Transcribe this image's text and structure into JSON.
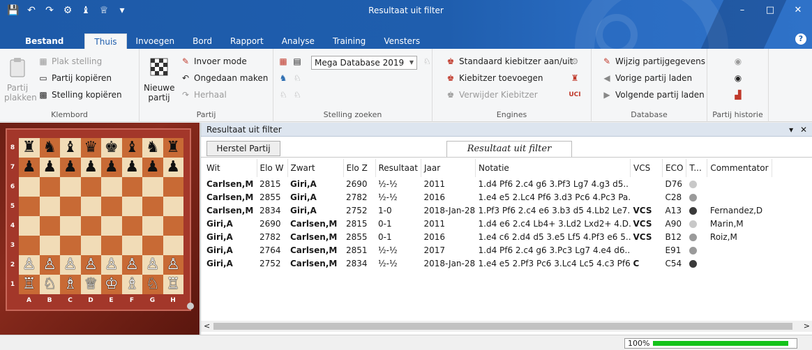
{
  "window": {
    "title": "Resultaat uit filter",
    "help": "?",
    "controls": {
      "minimize": "–",
      "maximize": "□",
      "close": "✕"
    }
  },
  "quick_access": [
    {
      "name": "save-icon",
      "glyph": "💾"
    },
    {
      "name": "undo-icon",
      "glyph": "↶"
    },
    {
      "name": "redo-icon",
      "glyph": "↷"
    },
    {
      "name": "engine-icon",
      "glyph": "⚙"
    },
    {
      "name": "analysis-icon",
      "glyph": "♝"
    },
    {
      "name": "trophy-icon",
      "glyph": "♕"
    },
    {
      "name": "customize-icon",
      "glyph": "▾"
    }
  ],
  "tabs": [
    {
      "label": "Bestand",
      "active": false
    },
    {
      "label": "Thuis",
      "active": true
    },
    {
      "label": "Invoegen",
      "active": false
    },
    {
      "label": "Bord",
      "active": false
    },
    {
      "label": "Rapport",
      "active": false
    },
    {
      "label": "Analyse",
      "active": false
    },
    {
      "label": "Training",
      "active": false
    },
    {
      "label": "Vensters",
      "active": false
    }
  ],
  "ribbon": {
    "klembord": {
      "label": "Klembord",
      "partij_plakken": "Partij plakken",
      "plak_stelling": "Plak stelling",
      "partij_kopieren": "Partij kopiëren",
      "stelling_kopieren": "Stelling kopiëren"
    },
    "partij": {
      "label": "Partij",
      "nieuwe_partij": "Nieuwe partij",
      "invoer_mode": "Invoer mode",
      "ongedaan": "Ongedaan maken",
      "herhaal": "Herhaal"
    },
    "stelling_zoeken": {
      "label": "Stelling zoeken",
      "database": "Mega Database 2019"
    },
    "engines": {
      "label": "Engines",
      "standaard": "Standaard kiebitzer aan/uit",
      "toevoegen": "Kiebitzer toevoegen",
      "verwijder": "Verwijder Kiebitzer",
      "uci": "UCI"
    },
    "database": {
      "label": "Database",
      "wijzig": "Wijzig partijgegevens",
      "vorige": "Vorige partij laden",
      "volgende": "Volgende partij laden"
    },
    "historie": {
      "label": "Partij historie"
    }
  },
  "board": {
    "ranks": [
      "8",
      "7",
      "6",
      "5",
      "4",
      "3",
      "2",
      "1"
    ],
    "files": [
      "A",
      "B",
      "C",
      "D",
      "E",
      "F",
      "G",
      "H"
    ],
    "position": [
      [
        "♜",
        "♞",
        "♝",
        "♛",
        "♚",
        "♝",
        "♞",
        "♜"
      ],
      [
        "♟",
        "♟",
        "♟",
        "♟",
        "♟",
        "♟",
        "♟",
        "♟"
      ],
      [
        "",
        "",
        "",
        "",
        "",
        "",
        "",
        ""
      ],
      [
        "",
        "",
        "",
        "",
        "",
        "",
        "",
        ""
      ],
      [
        "",
        "",
        "",
        "",
        "",
        "",
        "",
        ""
      ],
      [
        "",
        "",
        "",
        "",
        "",
        "",
        "",
        ""
      ],
      [
        "♙",
        "♙",
        "♙",
        "♙",
        "♙",
        "♙",
        "♙",
        "♙"
      ],
      [
        "♖",
        "♘",
        "♗",
        "♕",
        "♔",
        "♗",
        "♘",
        "♖"
      ]
    ]
  },
  "results": {
    "panel_title": "Resultaat uit filter",
    "controls": {
      "menu": "▾",
      "close": "✕"
    },
    "herstel_button": "Herstel Partij",
    "filter_tab": "Resultaat uit filter",
    "columns": [
      "Wit",
      "Elo W",
      "Zwart",
      "Elo Z",
      "Resultaat",
      "Jaar",
      "Notatie",
      "VCS",
      "ECO",
      "T...",
      "Commentator"
    ],
    "rows": [
      {
        "wit": "Carlsen,M",
        "elo_w": "2815",
        "zwart": "Giri,A",
        "elo_z": "2690",
        "resultaat": "½-½",
        "jaar": "2011",
        "notatie": "1.d4 Pf6 2.c4 g6 3.Pf3 Lg7 4.g3 d5..",
        "vcs": "",
        "eco": "D76",
        "t": "light",
        "commentator": ""
      },
      {
        "wit": "Carlsen,M",
        "elo_w": "2855",
        "zwart": "Giri,A",
        "elo_z": "2782",
        "resultaat": "½-½",
        "jaar": "2016",
        "notatie": "1.e4 e5 2.Lc4 Pf6 3.d3 Pc6 4.Pc3 Pa.",
        "vcs": "",
        "eco": "C28",
        "t": "mid",
        "commentator": ""
      },
      {
        "wit": "Carlsen,M",
        "elo_w": "2834",
        "zwart": "Giri,A",
        "elo_z": "2752",
        "resultaat": "1-0",
        "jaar": "2018-Jan-28",
        "notatie": "1.Pf3 Pf6 2.c4 e6 3.b3 d5 4.Lb2 Le7..",
        "vcs": "VCS",
        "eco": "A13",
        "t": "dark",
        "commentator": "Fernandez,D"
      },
      {
        "wit": "Giri,A",
        "elo_w": "2690",
        "zwart": "Carlsen,M",
        "elo_z": "2815",
        "resultaat": "0-1",
        "jaar": "2011",
        "notatie": "1.d4 e6 2.c4 Lb4+ 3.Ld2 Lxd2+ 4.D..",
        "vcs": "VCS",
        "eco": "A90",
        "t": "light",
        "commentator": "Marin,M"
      },
      {
        "wit": "Giri,A",
        "elo_w": "2782",
        "zwart": "Carlsen,M",
        "elo_z": "2855",
        "resultaat": "0-1",
        "jaar": "2016",
        "notatie": "1.e4 c6 2.d4 d5 3.e5 Lf5 4.Pf3 e6 5..",
        "vcs": "VCS",
        "eco": "B12",
        "t": "mid",
        "commentator": "Roiz,M"
      },
      {
        "wit": "Giri,A",
        "elo_w": "2764",
        "zwart": "Carlsen,M",
        "elo_z": "2851",
        "resultaat": "½-½",
        "jaar": "2017",
        "notatie": "1.d4 Pf6 2.c4 g6 3.Pc3 Lg7 4.e4 d6..",
        "vcs": "",
        "eco": "E91",
        "t": "mid",
        "commentator": ""
      },
      {
        "wit": "Giri,A",
        "elo_w": "2752",
        "zwart": "Carlsen,M",
        "elo_z": "2834",
        "resultaat": "½-½",
        "jaar": "2018-Jan-28",
        "notatie": "1.e4 e5 2.Pf3 Pc6 3.Lc4 Lc5 4.c3 Pf6..",
        "vcs": "C",
        "eco": "C54",
        "t": "dark",
        "commentator": ""
      }
    ],
    "scroll": {
      "left": "<",
      "right": ">"
    }
  },
  "status": {
    "zoom": "100%",
    "progress": 0.95
  },
  "colors": {
    "title_bar": "#1f5eae",
    "progress_fill": "#14c21a",
    "light_square": "#f1dcb7",
    "dark_square": "#c86a35",
    "board_frame": "#8a2b1d",
    "dot_light": "#c8c8c8",
    "dot_mid": "#9a9a9a",
    "dot_dark": "#3a3a3a"
  }
}
